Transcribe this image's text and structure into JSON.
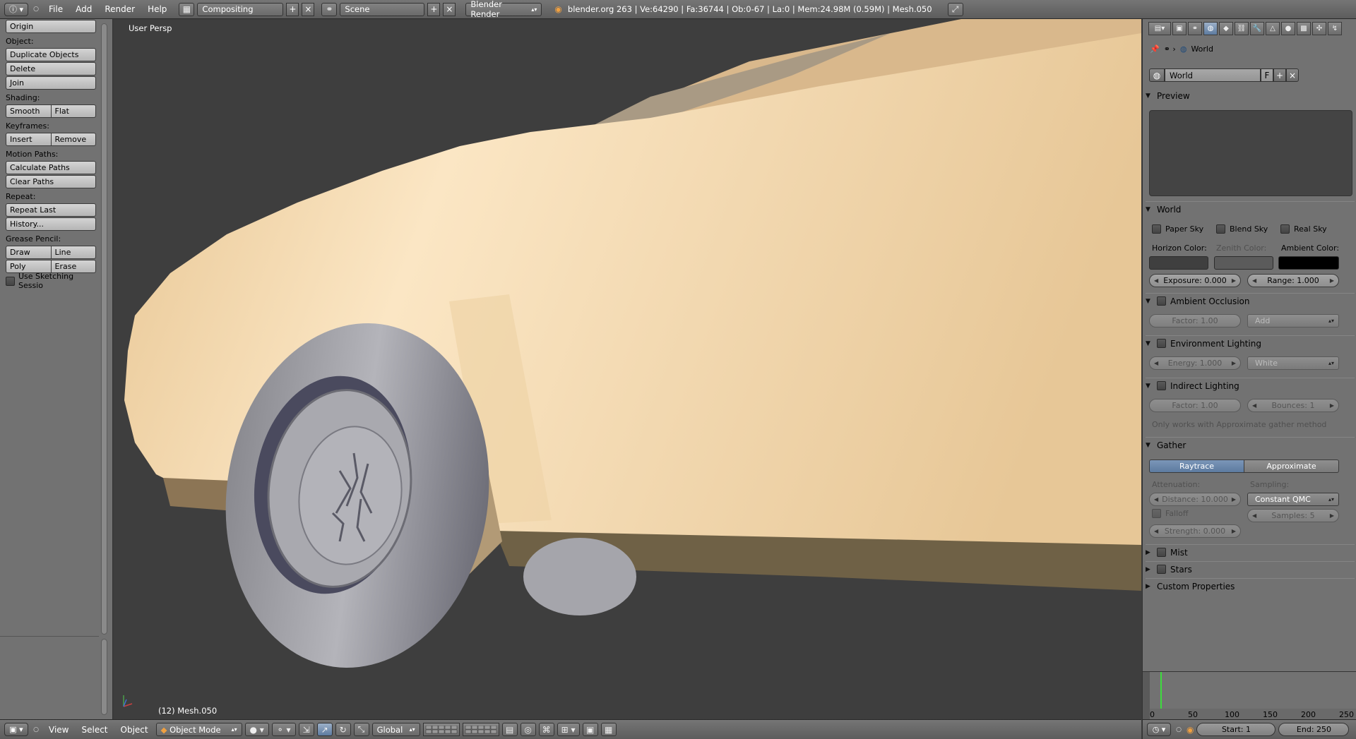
{
  "header": {
    "menus": [
      "File",
      "Add",
      "Render",
      "Help"
    ],
    "layout": "Compositing",
    "scene": "Scene",
    "engine": "Blender Render",
    "status": "blender.org 263 | Ve:64290 | Fa:36744 | Ob:0-67 | La:0 | Mem:24.98M (0.59M) | Mesh.050"
  },
  "toolshelf": {
    "origin": "Origin",
    "object_label": "Object:",
    "duplicate": "Duplicate Objects",
    "delete": "Delete",
    "join": "Join",
    "shading_label": "Shading:",
    "smooth": "Smooth",
    "flat": "Flat",
    "keyframes_label": "Keyframes:",
    "insert": "Insert",
    "remove": "Remove",
    "motion_label": "Motion Paths:",
    "calc_paths": "Calculate Paths",
    "clear_paths": "Clear Paths",
    "repeat_label": "Repeat:",
    "repeat_last": "Repeat Last",
    "history": "History...",
    "grease_label": "Grease Pencil:",
    "draw": "Draw",
    "line": "Line",
    "poly": "Poly",
    "erase": "Erase",
    "sketching": "Use Sketching Sessio"
  },
  "viewport": {
    "view_name": "User Persp",
    "object_info": "(12) Mesh.050"
  },
  "view_header": {
    "menus": [
      "View",
      "Select",
      "Object"
    ],
    "mode": "Object Mode",
    "orientation": "Global"
  },
  "properties": {
    "path_world": "World",
    "world_name": "World",
    "fake_user": "F",
    "preview_title": "Preview",
    "world_title": "World",
    "paper_sky": "Paper Sky",
    "blend_sky": "Blend Sky",
    "real_sky": "Real Sky",
    "horizon_color": "Horizon Color:",
    "zenith_color": "Zenith Color:",
    "ambient_color": "Ambient Color:",
    "exposure": "Exposure: 0.000",
    "range": "Range: 1.000",
    "ao_title": "Ambient Occlusion",
    "ao_factor": "Factor: 1.00",
    "ao_blend": "Add",
    "env_title": "Environment Lighting",
    "env_energy": "Energy: 1.000",
    "env_color": "White",
    "indirect_title": "Indirect Lighting",
    "ind_factor": "Factor: 1.00",
    "ind_bounces": "Bounces: 1",
    "indirect_note": "Only works with Approximate gather method",
    "gather_title": "Gather",
    "raytrace": "Raytrace",
    "approximate": "Approximate",
    "attenuation": "Attenuation:",
    "sampling": "Sampling:",
    "distance": "Distance: 10.000",
    "sampling_method": "Constant QMC",
    "falloff": "Falloff",
    "samples": "Samples: 5",
    "strength": "Strength: 0.000",
    "mist_title": "Mist",
    "stars_title": "Stars",
    "custom_title": "Custom Properties",
    "horizon_hex": "#3f3f3f",
    "zenith_hex": "#5b5b5b",
    "ambient_hex": "#000000"
  },
  "timeline": {
    "ticks": [
      "0",
      "50",
      "100",
      "150",
      "200",
      "250"
    ],
    "start": "Start: 1",
    "end": "End: 250"
  },
  "colors": {
    "car_body": "#e8c797",
    "tire": "#9a9aa0",
    "viewport_bg": "#3e3e3e",
    "active_blue": "#5d7ba0"
  }
}
